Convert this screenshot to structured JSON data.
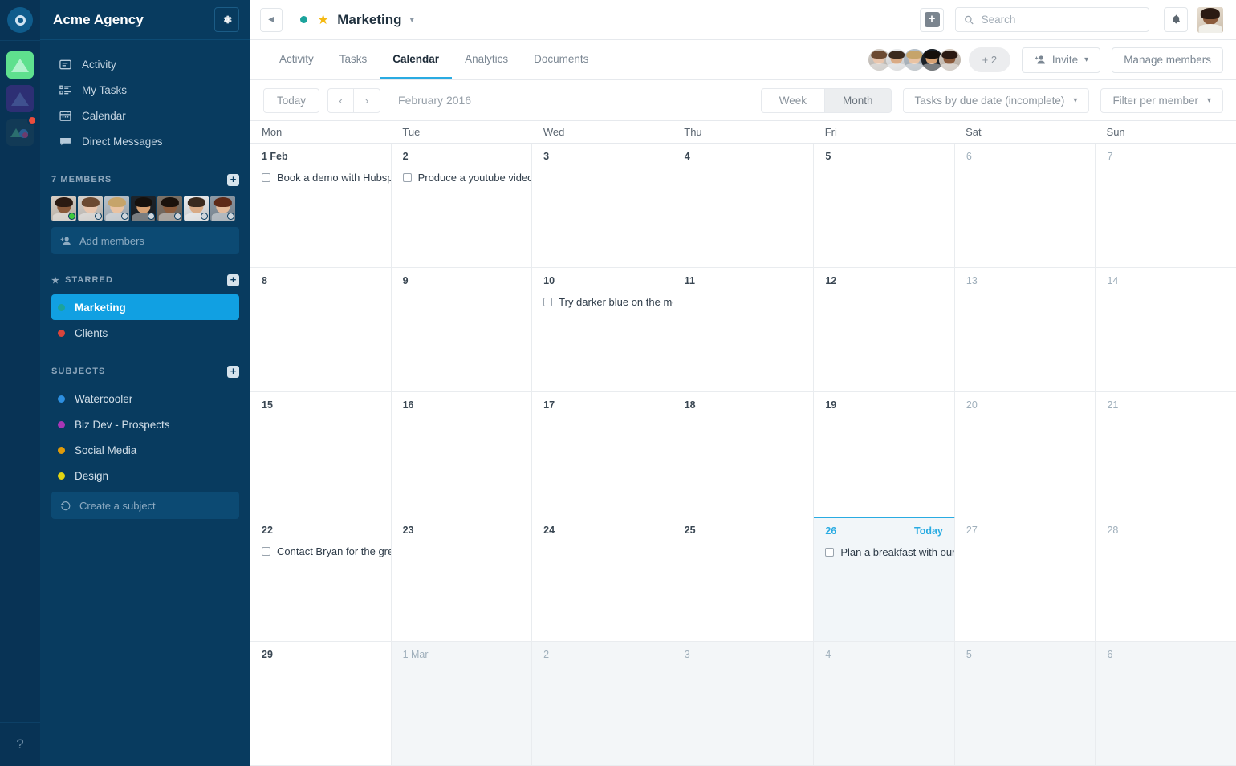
{
  "rail": {
    "logo_icon": "circle-logo-icon",
    "workspaces": [
      {
        "name": "workspace-green",
        "color": "#5fe08e",
        "badge": false
      },
      {
        "name": "workspace-indigo",
        "color": "#2d2f74",
        "badge": false
      },
      {
        "name": "workspace-dark",
        "color": "#123a56",
        "badge": true
      }
    ],
    "help_label": "?"
  },
  "sidebar": {
    "org_title": "Acme Agency",
    "settings_icon": "gear-icon",
    "nav": [
      {
        "label": "Activity",
        "icon": "activity-feed-icon"
      },
      {
        "label": "My Tasks",
        "icon": "tasks-list-icon"
      },
      {
        "label": "Calendar",
        "icon": "calendar-icon"
      },
      {
        "label": "Direct Messages",
        "icon": "chat-bubble-icon"
      }
    ],
    "members_section": {
      "label": "7 MEMBERS",
      "add_icon": "plus-square-icon",
      "add_members_placeholder": "Add members",
      "add_members_icon": "add-person-icon",
      "avatars": [
        {
          "status": "#3ec93e",
          "skin": "#8a5a3b",
          "hair": "#2b1a12",
          "bg": "#d9cfc4"
        },
        {
          "status": "#cfd6dc",
          "skin": "#e8c6ae",
          "hair": "#6b4a32",
          "bg": "#d7d2cc"
        },
        {
          "status": "#cfd6dc",
          "skin": "#e9c3a3",
          "hair": "#c6a46a",
          "bg": "#b9c3cc"
        },
        {
          "status": "#cfd6dc",
          "skin": "#d6a173",
          "hair": "#15100c",
          "bg": "#1d242b"
        },
        {
          "status": "#cfd6dc",
          "skin": "#8b5c3c",
          "hair": "#1a120c",
          "bg": "#7e7368"
        },
        {
          "status": "#cfd6dc",
          "skin": "#d9ab86",
          "hair": "#3a2a1e",
          "bg": "#eceef0"
        },
        {
          "status": "#cfd6dc",
          "skin": "#e4bb9c",
          "hair": "#5e2a18",
          "bg": "#8d9aa6"
        }
      ]
    },
    "starred_section": {
      "label": "STARRED",
      "star_icon": "star-icon",
      "add_icon": "plus-square-icon",
      "items": [
        {
          "label": "Marketing",
          "color": "#1ba39c",
          "active": true
        },
        {
          "label": "Clients",
          "color": "#d9453c",
          "active": false
        }
      ]
    },
    "subjects_section": {
      "label": "SUBJECTS",
      "add_icon": "plus-square-icon",
      "items": [
        {
          "label": "Watercooler",
          "color": "#2d8fe0"
        },
        {
          "label": "Biz Dev - Prospects",
          "color": "#a836b5"
        },
        {
          "label": "Social Media",
          "color": "#e09b0a"
        },
        {
          "label": "Design",
          "color": "#e2d412"
        }
      ],
      "create_label": "Create a subject",
      "create_icon": "history-restore-icon"
    }
  },
  "topbar": {
    "collapse_icon": "collapse-left-icon",
    "project_status_color": "#1ba39c",
    "star_icon": "star-icon",
    "project_name": "Marketing",
    "project_caret_icon": "chevron-down-icon",
    "add_icon": "plus-square-icon",
    "search_placeholder": "Search",
    "search_value": "",
    "search_icon": "search-icon",
    "notifications_icon": "bell-icon",
    "user_avatar_name": "current-user-avatar"
  },
  "tabs": [
    {
      "label": "Activity",
      "active": false
    },
    {
      "label": "Tasks",
      "active": false
    },
    {
      "label": "Calendar",
      "active": true
    },
    {
      "label": "Analytics",
      "active": false
    },
    {
      "label": "Documents",
      "active": false
    }
  ],
  "members_bar": {
    "overflow_label": "+ 2",
    "invite_label": "Invite",
    "invite_icon": "add-person-icon",
    "invite_caret_icon": "chevron-down-icon",
    "manage_label": "Manage members",
    "avatars": [
      {
        "skin": "#e8c6ae",
        "hair": "#6b4a32",
        "bg": "#d7d2cc"
      },
      {
        "skin": "#d9ab86",
        "hair": "#3a2a1e",
        "bg": "#eceef0"
      },
      {
        "skin": "#e9c3a3",
        "hair": "#c6a46a",
        "bg": "#b9c3cc"
      },
      {
        "skin": "#d6a173",
        "hair": "#15100c",
        "bg": "#1d242b"
      },
      {
        "skin": "#8a5a3b",
        "hair": "#2b1a12",
        "bg": "#d9cfc4"
      }
    ]
  },
  "toolbar": {
    "today_label": "Today",
    "prev_icon": "chevron-left-icon",
    "next_icon": "chevron-right-icon",
    "month_label": "February 2016",
    "view_week_label": "Week",
    "view_month_label": "Month",
    "view_selected": "Month",
    "grouping_label": "Tasks by due date (incomplete)",
    "grouping_caret_icon": "chevron-down-icon",
    "filter_label": "Filter per member",
    "filter_caret_icon": "chevron-down-icon"
  },
  "calendar": {
    "weekday_headers": [
      "Mon",
      "Tue",
      "Wed",
      "Thu",
      "Fri",
      "Sat",
      "Sun"
    ],
    "today_tag": "Today",
    "weeks": [
      [
        {
          "num": "1 Feb",
          "dim": false,
          "out": false,
          "today": false,
          "tasks": [
            {
              "label": "Book a demo with Hubspot",
              "done": false
            }
          ]
        },
        {
          "num": "2",
          "dim": false,
          "out": false,
          "today": false,
          "tasks": [
            {
              "label": "Produce a youtube video for the new product",
              "done": false
            }
          ]
        },
        {
          "num": "3",
          "dim": false,
          "out": false,
          "today": false,
          "tasks": []
        },
        {
          "num": "4",
          "dim": false,
          "out": false,
          "today": false,
          "tasks": []
        },
        {
          "num": "5",
          "dim": false,
          "out": false,
          "today": false,
          "tasks": []
        },
        {
          "num": "6",
          "dim": true,
          "out": false,
          "today": false,
          "tasks": []
        },
        {
          "num": "7",
          "dim": true,
          "out": false,
          "today": false,
          "tasks": []
        }
      ],
      [
        {
          "num": "8",
          "dim": false,
          "out": false,
          "today": false,
          "tasks": []
        },
        {
          "num": "9",
          "dim": false,
          "out": false,
          "today": false,
          "tasks": []
        },
        {
          "num": "10",
          "dim": false,
          "out": false,
          "today": false,
          "tasks": [
            {
              "label": "Try darker blue on the mobile app",
              "done": false
            }
          ]
        },
        {
          "num": "11",
          "dim": false,
          "out": false,
          "today": false,
          "tasks": []
        },
        {
          "num": "12",
          "dim": false,
          "out": false,
          "today": false,
          "tasks": []
        },
        {
          "num": "13",
          "dim": true,
          "out": false,
          "today": false,
          "tasks": []
        },
        {
          "num": "14",
          "dim": true,
          "out": false,
          "today": false,
          "tasks": []
        }
      ],
      [
        {
          "num": "15",
          "dim": false,
          "out": false,
          "today": false,
          "tasks": []
        },
        {
          "num": "16",
          "dim": false,
          "out": false,
          "today": false,
          "tasks": []
        },
        {
          "num": "17",
          "dim": false,
          "out": false,
          "today": false,
          "tasks": []
        },
        {
          "num": "18",
          "dim": false,
          "out": false,
          "today": false,
          "tasks": []
        },
        {
          "num": "19",
          "dim": false,
          "out": false,
          "today": false,
          "tasks": []
        },
        {
          "num": "20",
          "dim": true,
          "out": false,
          "today": false,
          "tasks": []
        },
        {
          "num": "21",
          "dim": true,
          "out": false,
          "today": false,
          "tasks": []
        }
      ],
      [
        {
          "num": "22",
          "dim": false,
          "out": false,
          "today": false,
          "tasks": [
            {
              "label": "Contact Bryan for the greeting card design",
              "done": false
            }
          ]
        },
        {
          "num": "23",
          "dim": false,
          "out": false,
          "today": false,
          "tasks": []
        },
        {
          "num": "24",
          "dim": false,
          "out": false,
          "today": false,
          "tasks": []
        },
        {
          "num": "25",
          "dim": false,
          "out": false,
          "today": false,
          "tasks": []
        },
        {
          "num": "26",
          "dim": false,
          "out": false,
          "today": true,
          "tasks": [
            {
              "label": "Plan a breakfast with our partners",
              "done": false
            }
          ]
        },
        {
          "num": "27",
          "dim": true,
          "out": false,
          "today": false,
          "tasks": []
        },
        {
          "num": "28",
          "dim": true,
          "out": false,
          "today": false,
          "tasks": []
        }
      ],
      [
        {
          "num": "29",
          "dim": false,
          "out": false,
          "today": false,
          "tasks": []
        },
        {
          "num": "1 Mar",
          "dim": true,
          "out": true,
          "today": false,
          "tasks": []
        },
        {
          "num": "2",
          "dim": true,
          "out": true,
          "today": false,
          "tasks": []
        },
        {
          "num": "3",
          "dim": true,
          "out": true,
          "today": false,
          "tasks": []
        },
        {
          "num": "4",
          "dim": true,
          "out": true,
          "today": false,
          "tasks": []
        },
        {
          "num": "5",
          "dim": true,
          "out": true,
          "today": false,
          "tasks": []
        },
        {
          "num": "6",
          "dim": true,
          "out": true,
          "today": false,
          "tasks": []
        }
      ]
    ]
  },
  "colors": {
    "sidebar_bg": "#083b5f",
    "rail_bg": "#083355",
    "accent_blue": "#29abe2",
    "active_item": "#11a0e2",
    "today_bg": "#f2f6f9",
    "out_month_bg": "#f3f6f8"
  }
}
